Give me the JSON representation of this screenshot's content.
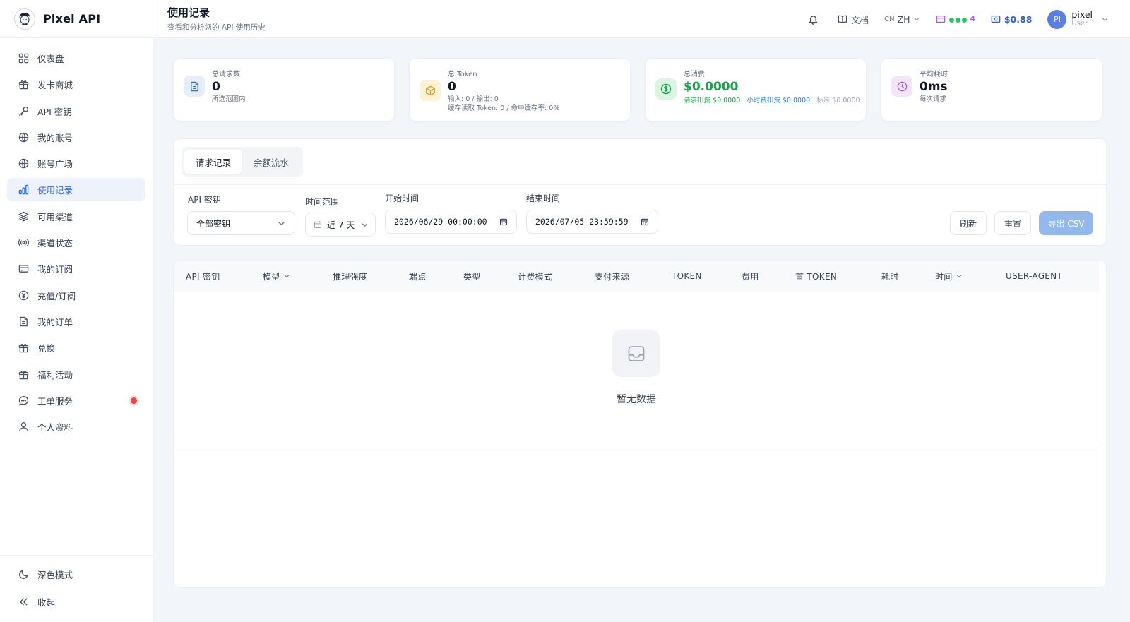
{
  "app": {
    "name": "Pixel API"
  },
  "sidebar": {
    "items": [
      {
        "label": "仪表盘",
        "icon": "dashboard-icon"
      },
      {
        "label": "发卡商城",
        "icon": "gift-icon"
      },
      {
        "label": "API 密钥",
        "icon": "key-icon"
      },
      {
        "label": "我的账号",
        "icon": "globe-icon"
      },
      {
        "label": "账号广场",
        "icon": "globe-icon"
      },
      {
        "label": "使用记录",
        "icon": "bar-chart-icon",
        "active": true
      },
      {
        "label": "可用渠道",
        "icon": "layers-icon"
      },
      {
        "label": "渠道状态",
        "icon": "signal-icon"
      },
      {
        "label": "我的订阅",
        "icon": "card-icon"
      },
      {
        "label": "充值/订阅",
        "icon": "yen-icon"
      },
      {
        "label": "我的订单",
        "icon": "document-icon"
      },
      {
        "label": "兑换",
        "icon": "gift-icon"
      },
      {
        "label": "福利活动",
        "icon": "gift-icon"
      },
      {
        "label": "工单服务",
        "icon": "chat-icon",
        "notification": true
      },
      {
        "label": "个人资料",
        "icon": "user-icon"
      }
    ],
    "bottom": {
      "dark_mode": "深色模式",
      "collapse": "收起"
    }
  },
  "header": {
    "title": "使用记录",
    "subtitle": "查看和分析您的 API 使用历史",
    "docs": "文档",
    "lang_prefix": "CN",
    "lang": "ZH",
    "subscription_count": "4",
    "balance": "$0.88",
    "avatar_initials": "PI",
    "user_name": "pixel",
    "user_role": "User"
  },
  "stats": {
    "requests": {
      "label": "总请求数",
      "value": "0",
      "sub": "所选范围内"
    },
    "tokens": {
      "label": "总 Token",
      "value": "0",
      "sub1": "输入: 0 / 输出: 0",
      "sub2": "缓存读取 Token: 0 / 命中缓存率: 0%"
    },
    "cost": {
      "label": "总消费",
      "value": "$0.0000",
      "request_fee": "请求扣费 $0.0000",
      "hourly_fee": "小时费扣费 $0.0000",
      "standard": "标准 $0.0000"
    },
    "latency": {
      "label": "平均耗时",
      "value": "0ms",
      "sub": "每次请求"
    }
  },
  "tabs": [
    "请求记录",
    "余额流水"
  ],
  "filters": {
    "api_key_label": "API 密钥",
    "api_key_value": "全部密钥",
    "range_label": "时间范围",
    "range_value": "近 7 天",
    "start_label": "开始时间",
    "start_value": "2026/06/29 00:00:00",
    "end_label": "结束时间",
    "end_value": "2026/07/05 23:59:59",
    "refresh": "刷新",
    "reset": "重置",
    "export": "导出 CSV"
  },
  "table": {
    "columns": [
      "API 密钥",
      "模型",
      "推理强度",
      "端点",
      "类型",
      "计费模式",
      "支付来源",
      "TOKEN",
      "费用",
      "首 TOKEN",
      "耗时",
      "时间",
      "USER-AGENT"
    ],
    "empty_text": "暂无数据"
  },
  "colors": {
    "accent": "#3b6fd8",
    "success": "#16a34a",
    "export_button": "#93b9ec",
    "notification": "#ef4444"
  }
}
